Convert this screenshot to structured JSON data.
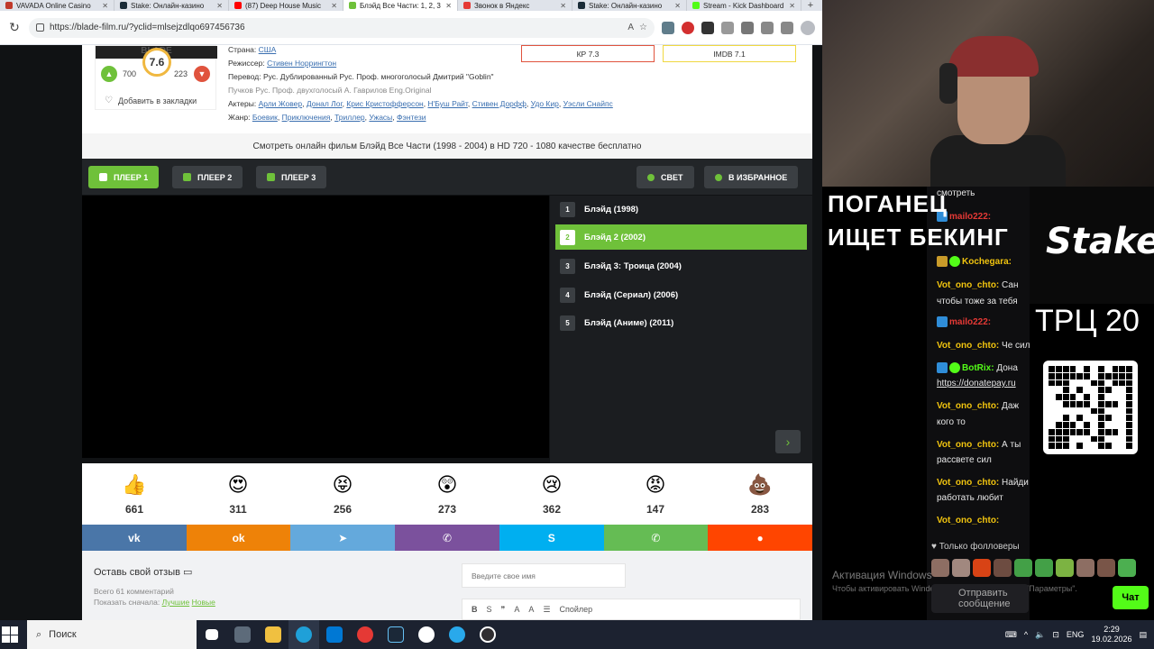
{
  "browser": {
    "tabs": [
      {
        "label": "VAVADA Online Casino",
        "color": "#c0392b"
      },
      {
        "label": "Stake: Онлайн-казино",
        "color": "#1a2c38"
      },
      {
        "label": "(87) Deep House Music",
        "color": "#ff0000"
      },
      {
        "label": "Блэйд Все Части: 1, 2, 3",
        "color": "#6fc13a",
        "active": true
      },
      {
        "label": "Звонок в Яндекс",
        "color": "#e53935"
      },
      {
        "label": "Stake: Онлайн-казино",
        "color": "#1a2c38"
      },
      {
        "label": "Stream - Kick Dashboard",
        "color": "#53fc18"
      }
    ],
    "new_tab": "+",
    "url": "https://blade-film.ru/?yclid=mlsejzdlqo697456736"
  },
  "movie": {
    "rating": "7.6",
    "likes": "700",
    "dislikes": "223",
    "bookmark_label": "Добавить в закладки",
    "country_label": "Страна:",
    "country": "США",
    "director_label": "Режиссер:",
    "director": "Стивен Норрингтон",
    "translation_label": "Перевод:",
    "translation": "Рус. Дублированный Рус. Проф. многоголосый Дмитрий \"Goblin\"",
    "translation2": "Пучков Рус. Проф. двухголосый А. Гаврилов Eng.Original",
    "actors_label": "Актеры:",
    "actors": [
      "Арли Жовер",
      "Донал Лог",
      "Крис Кристофферсон",
      "Н'Буш Райт",
      "Стивен Дорфф",
      "Удо Кир",
      "Уэсли Снайпс"
    ],
    "genre_label": "Жанр:",
    "genres": [
      "Боевик",
      "Приключения",
      "Триллер",
      "Ужасы",
      "Фэнтези"
    ],
    "kp": "КР 7.3",
    "imdb": "IMDB 7.1",
    "watch_title": "Смотреть онлайн фильм Блэйд Все Части (1998 - 2004) в HD 720 - 1080 качестве бесплатно"
  },
  "player": {
    "tabs": [
      "ПЛЕЕР 1",
      "ПЛЕЕР 2",
      "ПЛЕЕР 3"
    ],
    "light": "СВЕТ",
    "favorites": "В ИЗБРАННОЕ",
    "episodes": [
      {
        "num": "1",
        "title": "Блэйд (1998)"
      },
      {
        "num": "2",
        "title": "Блэйд 2 (2002)",
        "active": true
      },
      {
        "num": "3",
        "title": "Блэйд 3: Троица (2004)"
      },
      {
        "num": "4",
        "title": "Блэйд (Сериал) (2006)"
      },
      {
        "num": "5",
        "title": "Блэйд (Аниме) (2011)"
      }
    ],
    "next_arrow": "›"
  },
  "reactions": [
    {
      "icon": "thumbs-up-icon",
      "glyph": "👍",
      "count": "661"
    },
    {
      "icon": "heart-eyes-icon",
      "glyph": "😍",
      "count": "311"
    },
    {
      "icon": "laughing-icon",
      "glyph": "😝",
      "count": "256"
    },
    {
      "icon": "surprised-icon",
      "glyph": "😲",
      "count": "273"
    },
    {
      "icon": "sad-icon",
      "glyph": "😢",
      "count": "362"
    },
    {
      "icon": "angry-icon",
      "glyph": "😡",
      "count": "147"
    },
    {
      "icon": "poop-icon",
      "glyph": "💩",
      "count": "283"
    }
  ],
  "share": [
    {
      "name": "vk",
      "glyph": "vk",
      "color": "#4a76a8"
    },
    {
      "name": "ok",
      "glyph": "ok",
      "color": "#ee8208"
    },
    {
      "name": "telegram",
      "glyph": "➤",
      "color": "#64a9dc"
    },
    {
      "name": "viber",
      "glyph": "✆",
      "color": "#7b519d"
    },
    {
      "name": "skype",
      "glyph": "S",
      "color": "#00aff0"
    },
    {
      "name": "whatsapp",
      "glyph": "✆",
      "color": "#65bc54"
    },
    {
      "name": "reddit",
      "glyph": "●",
      "color": "#ff4500"
    }
  ],
  "comments": {
    "heading": "Оставь свой отзыв",
    "total": "Всего 61 комментарий",
    "sort_label": "Показать сначала:",
    "sort_best": "Лучшие",
    "sort_new": "Новые",
    "name_placeholder": "Введите свое имя",
    "spoiler": "Спойлер"
  },
  "stream": {
    "headline1": "ПОГАНЕЦ",
    "headline2": "ИЩЕТ БЕКИНГ",
    "stake": "Stake",
    "trc": "ТРЦ 20",
    "chat": [
      {
        "user": "",
        "text": "смотреть"
      },
      {
        "user": "mailo222:",
        "text": "",
        "color": "#e53935"
      },
      {
        "user": "",
        "text": ""
      },
      {
        "user": "Kochegara:",
        "text": "",
        "color": "#f1c40f"
      },
      {
        "user": "Vot_ono_chto:",
        "text": "Сан",
        "color": "#f1c40f"
      },
      {
        "user": "",
        "text": "чтобы тоже за тебя"
      },
      {
        "user": "mailo222:",
        "text": "",
        "color": "#e53935"
      },
      {
        "user": "Vot_ono_chto:",
        "text": "Че силишь перлишь",
        "color": "#f1c40f"
      },
      {
        "user": "BotRix:",
        "text": "Дона",
        "color": "#53fc18"
      },
      {
        "user": "",
        "text": "https://donatepay.ru"
      },
      {
        "user": "Vot_ono_chto:",
        "text": "Даж",
        "color": "#f1c40f"
      },
      {
        "user": "",
        "text": "кого то"
      },
      {
        "user": "Vot_ono_chto:",
        "text": "А ты",
        "color": "#f1c40f"
      },
      {
        "user": "",
        "text": "рассвете сил"
      },
      {
        "user": "Vot_ono_chto:",
        "text": "Найди телочку которая",
        "color": "#f1c40f"
      },
      {
        "user": "",
        "text": "работать любит"
      },
      {
        "user": "Vot_ono_chto:",
        "text": "",
        "color": "#f1c40f"
      }
    ],
    "followers_only": "Только фолловеры",
    "input_placeholder": "Отправить сообщение",
    "chat_button": "Чат",
    "activation_title": "Активация Windows",
    "activation_text": "Чтобы активировать Windows, перейдите в раздел \"Параметры\"."
  },
  "taskbar": {
    "search": "Поиск",
    "lang": "ENG",
    "time": "2:29",
    "date": "19.02.2026"
  }
}
